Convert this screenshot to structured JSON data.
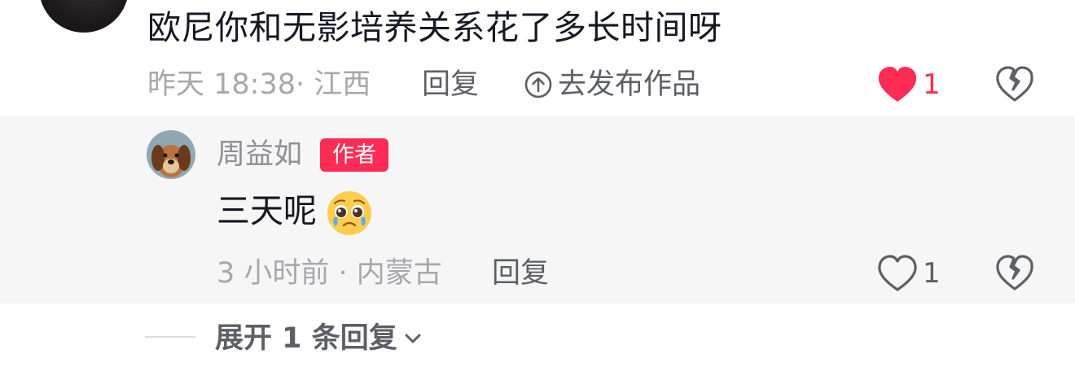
{
  "comment": {
    "text": "欧尼你和无影培养关系花了多长时间呀",
    "time_location": "昨天 18:38· 江西",
    "reply_label": "回复",
    "publish_label": "去发布作品",
    "like_count": "1",
    "liked": true,
    "like_color": "#fe2c55"
  },
  "reply": {
    "username": "周益如",
    "author_badge": "作者",
    "text": "三天呢",
    "emoji": "pleading-face-emoji",
    "time_location": "3 小时前 · 内蒙古",
    "reply_label": "回复",
    "like_count": "1",
    "liked": false
  },
  "expand": {
    "label": "展开 1 条回复"
  },
  "colors": {
    "background": "#ffffff",
    "reply_background": "#f6f6f7",
    "primary_text": "#161823",
    "secondary_text": "#a7a8ad",
    "accent": "#fe2c55"
  }
}
